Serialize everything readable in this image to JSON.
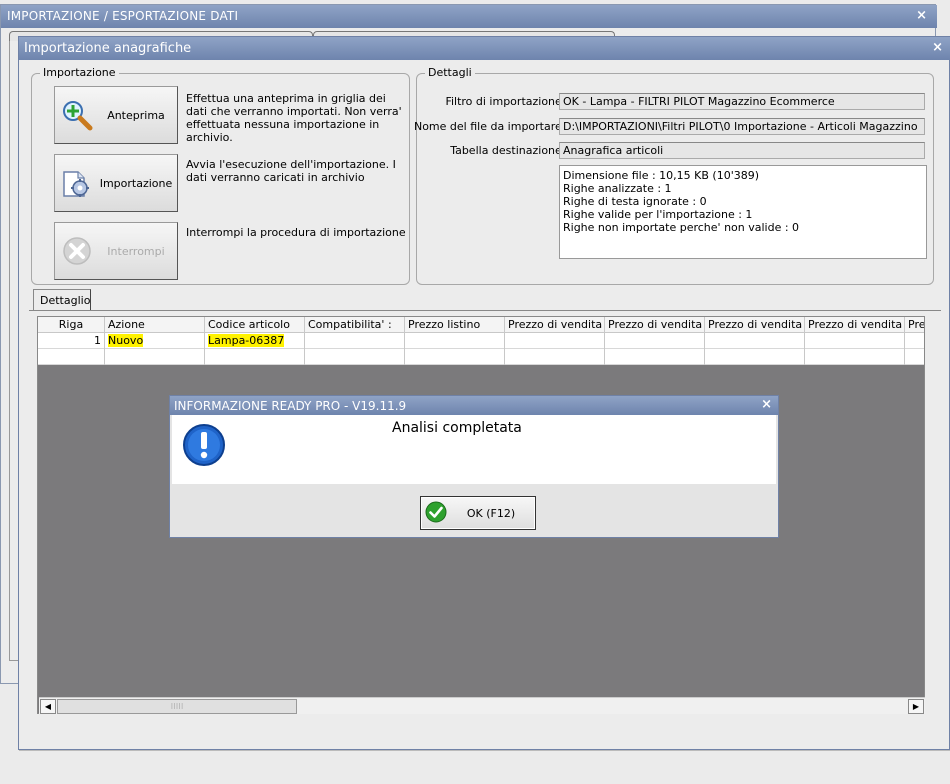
{
  "outer_window": {
    "title": "IMPORTAZIONE / ESPORTAZIONE DATI",
    "close": "×"
  },
  "main_window": {
    "title": "Importazione anagrafiche",
    "close": "×"
  },
  "importazione": {
    "legend": "Importazione",
    "buttons": [
      {
        "label": "Anteprima",
        "icon": "zoom-add-icon",
        "description": "Effettua una anteprima in griglia dei dati che verranno importati. Non verra' effettuata nessuna importazione in archivio."
      },
      {
        "label": "Importazione",
        "icon": "document-gear-icon",
        "description": "Avvia l'esecuzione dell'importazione. I dati verranno caricati in archivio"
      },
      {
        "label": "Interrompi",
        "icon": "stop-icon",
        "description": "Interrompi la procedura di importazione",
        "disabled": true
      }
    ]
  },
  "dettagli": {
    "legend": "Dettagli",
    "filtro_label": "Filtro di importazione :",
    "filtro_value": "OK - Lampa - FILTRI PILOT Magazzino Ecommerce",
    "file_label": "Nome del file da importare :",
    "file_value": "D:\\IMPORTAZIONI\\Filtri PILOT\\0 Importazione - Articoli Magazzino",
    "tabella_label": "Tabella destinazione :",
    "tabella_value": "Anagrafica articoli",
    "info_lines": [
      "Dimensione file : 10,15 KB (10'389)",
      "Righe analizzate : 1",
      "Righe di testa ignorate : 0",
      "Righe valide per l'importazione : 1",
      "Righe non importate perche' non valide : 0"
    ]
  },
  "tab": {
    "label": "Dettaglio"
  },
  "grid": {
    "columns": [
      "Riga",
      "Azione",
      "Codice articolo",
      "Compatibilita' :",
      "Prezzo listino",
      "Prezzo di vendita",
      "Prezzo di vendita",
      "Prezzo di vendita",
      "Prezzo di vendita",
      "Prez"
    ],
    "rows": [
      {
        "riga": "1",
        "azione": "Nuovo",
        "codice": "Lampa-06387"
      }
    ]
  },
  "message_box": {
    "title": "INFORMAZIONE READY PRO - V19.11.9",
    "close": "×",
    "text": "Analisi completata",
    "ok_label": "OK (F12)"
  },
  "colors": {
    "titlebar": "#7f94ba",
    "highlight": "#fff200",
    "grid_bg": "#7b7a7c"
  }
}
